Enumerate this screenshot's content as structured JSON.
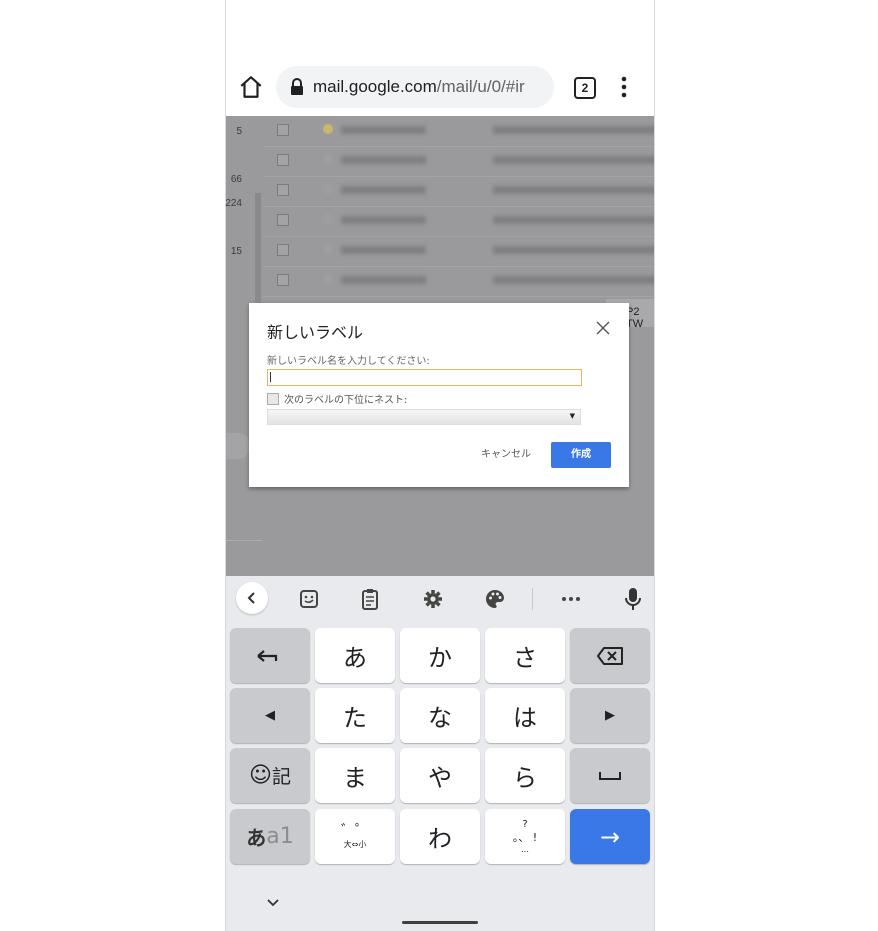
{
  "browser": {
    "url_host": "mail.google.com",
    "url_path": "/mail/u/0/#ir",
    "tab_count": "2",
    "icons": [
      "home-icon",
      "lock-icon",
      "tab-switcher-icon",
      "more-vert-icon"
    ]
  },
  "background": {
    "sidebar_counts": [
      "5",
      "66",
      "224",
      "15"
    ],
    "row_count": 6,
    "peek_text": "P2 TW"
  },
  "dialog": {
    "title": "新しいラベル",
    "label_prompt": "新しいラベル名を入力してください:",
    "input_value": "",
    "nest_label": "次のラベルの下位にネスト:",
    "nest_checked": false,
    "select_value": "",
    "cancel_label": "キャンセル",
    "create_label": "作成",
    "accent_color": "#3b78e7"
  },
  "keyboard": {
    "toolbar": [
      "back-icon",
      "sticker-icon",
      "clipboard-icon",
      "settings-icon",
      "palette-icon",
      "more-horiz-icon",
      "mic-icon"
    ],
    "rows": [
      [
        "←",
        "あ",
        "か",
        "さ",
        "⌫"
      ],
      [
        "◀",
        "た",
        "な",
        "は",
        "▶"
      ],
      [
        "☺記",
        "ま",
        "や",
        "ら",
        "␣"
      ],
      [
        "あa1",
        "゛゜ 大⇔小",
        "わ",
        "、。?!",
        "→"
      ]
    ],
    "labels": {
      "undo": "←",
      "a": "あ",
      "ka": "か",
      "sa": "さ",
      "left": "◀",
      "ta": "た",
      "na": "な",
      "ha": "は",
      "right": "▶",
      "emoji": "☺",
      "kigou": "記",
      "ma": "ま",
      "ya": "や",
      "ra": "ら",
      "mode_a": "あ",
      "mode_rest": "a1",
      "dakuten": "゛゜",
      "dakuten_sub": "大⇔小",
      "wa": "わ",
      "punct_top": "?",
      "punct_mid": "。、 !",
      "punct_bottom": "…",
      "enter": "→"
    }
  }
}
